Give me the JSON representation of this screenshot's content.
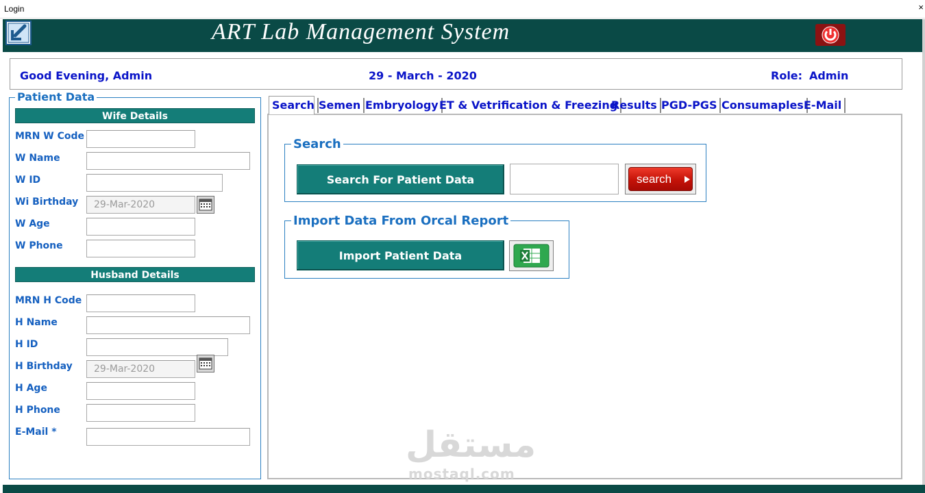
{
  "window": {
    "title": "Login",
    "close_glyph": "×"
  },
  "header": {
    "app_title": "ART Lab Management System",
    "back_icon": "back-arrow-icon",
    "power_icon": "power-icon",
    "bg_color": "#0a4a46"
  },
  "info": {
    "greeting": "Good Evening, Admin",
    "date": "29 - March - 2020",
    "role_label": "Role:",
    "role_value": "Admin"
  },
  "patient": {
    "panel_title": "Patient Data",
    "wife_header": "Wife Details",
    "husband_header": "Husband Details",
    "wife_fields": [
      {
        "label": "MRN W Code",
        "value": ""
      },
      {
        "label": "W Name",
        "value": ""
      },
      {
        "label": "W ID",
        "value": ""
      },
      {
        "label": "Wi Birthday",
        "value": "29-Mar-2020"
      },
      {
        "label": "W Age",
        "value": ""
      },
      {
        "label": "W Phone",
        "value": ""
      }
    ],
    "husband_fields": [
      {
        "label": "MRN H Code",
        "value": ""
      },
      {
        "label": "H Name",
        "value": ""
      },
      {
        "label": "H ID",
        "value": ""
      },
      {
        "label": "H Birthday",
        "value": "29-Mar-2020"
      },
      {
        "label": "H Age",
        "value": ""
      },
      {
        "label": "H Phone",
        "value": ""
      },
      {
        "label": "E-Mail *",
        "value": ""
      }
    ]
  },
  "tabs": [
    {
      "label": "Search",
      "selected": true
    },
    {
      "label": "Semen"
    },
    {
      "label": "Embryology"
    },
    {
      "label": "ET & Vetrification & Freezing"
    },
    {
      "label": "Results"
    },
    {
      "label": "PGD-PGS"
    },
    {
      "label": "Consumaples"
    },
    {
      "label": "E-Mail"
    }
  ],
  "search_group": {
    "title": "Search",
    "button": "Search For Patient Data",
    "input_value": "",
    "go_button": "search"
  },
  "import_group": {
    "title": "Import Data From Orcal Report",
    "button": "Import Patient Data",
    "excel_icon": "excel-icon"
  },
  "watermark": {
    "arabic": "مستقل",
    "latin": "mostaql.com"
  },
  "colors": {
    "accent": "#147d78",
    "label_blue": "#1560c0",
    "info_blue": "#0a14c8"
  }
}
